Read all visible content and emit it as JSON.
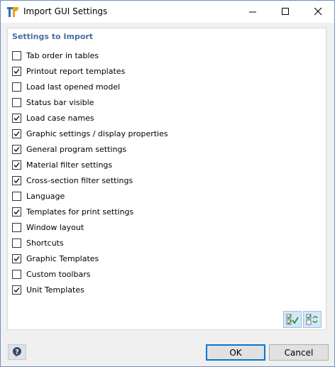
{
  "window": {
    "title": "Import GUI Settings"
  },
  "panel": {
    "section_title": "Settings to Import",
    "items": [
      {
        "label": "Tab order in tables",
        "checked": false
      },
      {
        "label": "Printout report templates",
        "checked": true
      },
      {
        "label": "Load last opened model",
        "checked": false
      },
      {
        "label": "Status bar visible",
        "checked": false
      },
      {
        "label": "Load case names",
        "checked": true
      },
      {
        "label": "Graphic settings / display properties",
        "checked": true
      },
      {
        "label": "General program settings",
        "checked": true
      },
      {
        "label": "Material filter settings",
        "checked": true
      },
      {
        "label": "Cross-section filter settings",
        "checked": true
      },
      {
        "label": "Language",
        "checked": false
      },
      {
        "label": "Templates for print settings",
        "checked": true
      },
      {
        "label": "Window layout",
        "checked": false
      },
      {
        "label": "Shortcuts",
        "checked": false
      },
      {
        "label": "Graphic Templates",
        "checked": true
      },
      {
        "label": "Custom toolbars",
        "checked": false
      },
      {
        "label": "Unit Templates",
        "checked": true
      }
    ]
  },
  "footer": {
    "ok_label": "OK",
    "cancel_label": "Cancel"
  },
  "icons": {
    "app": "rfem-logo-icon",
    "help": "help-icon",
    "select_all": "check-all-icon",
    "toggle": "toggle-selection-icon"
  },
  "colors": {
    "accent": "#0078d7",
    "section_title": "#4a6fa5",
    "tool_bg": "#d4e6f7"
  }
}
